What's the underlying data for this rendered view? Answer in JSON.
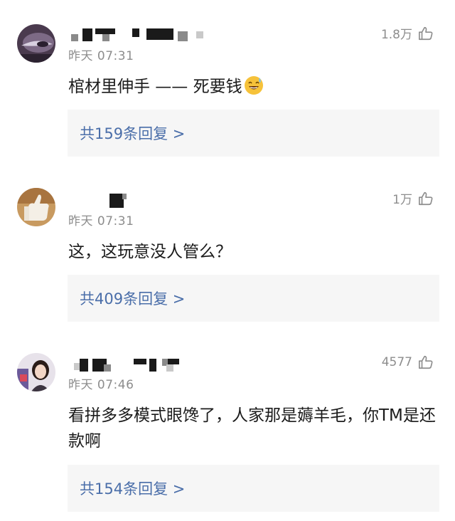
{
  "comments": [
    {
      "time": "昨天 07:31",
      "likes": "1.8万",
      "text": "棺材里伸手 —— 死要钱",
      "emoji": "sweat-smile-emoji",
      "replies": "共159条回复 >"
    },
    {
      "time": "昨天 07:31",
      "likes": "1万",
      "text": "这，这玩意没人管么？",
      "replies": "共409条回复 >"
    },
    {
      "time": "昨天 07:46",
      "likes": "4577",
      "text": "看拼多多模式眼馋了，人家那是薅羊毛，你TM是还款啊",
      "replies": "共154条回复 >"
    }
  ]
}
